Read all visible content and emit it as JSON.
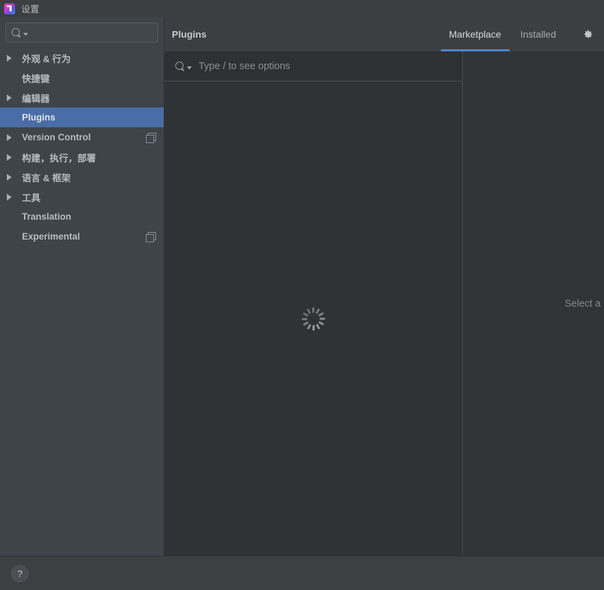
{
  "window": {
    "title": "设置",
    "app_icon": "pycharm-icon"
  },
  "sidebar": {
    "search": {
      "value": "",
      "placeholder": "",
      "icon": "search-icon"
    },
    "items": [
      {
        "label": "外观 & 行为",
        "expandable": true,
        "selected": false,
        "badge": ""
      },
      {
        "label": "快捷键",
        "expandable": false,
        "selected": false,
        "badge": ""
      },
      {
        "label": "编辑器",
        "expandable": true,
        "selected": false,
        "badge": ""
      },
      {
        "label": "Plugins",
        "expandable": false,
        "selected": true,
        "badge": ""
      },
      {
        "label": "Version Control",
        "expandable": true,
        "selected": false,
        "badge": "copy-icon"
      },
      {
        "label": "构建，执行，部署",
        "expandable": true,
        "selected": false,
        "badge": ""
      },
      {
        "label": "语言 & 框架",
        "expandable": true,
        "selected": false,
        "badge": ""
      },
      {
        "label": "工具",
        "expandable": true,
        "selected": false,
        "badge": ""
      },
      {
        "label": "Translation",
        "expandable": false,
        "selected": false,
        "badge": ""
      },
      {
        "label": "Experimental",
        "expandable": false,
        "selected": false,
        "badge": "copy-icon"
      }
    ]
  },
  "main": {
    "title": "Plugins",
    "tabs": [
      {
        "label": "Marketplace",
        "active": true
      },
      {
        "label": "Installed",
        "active": false
      }
    ],
    "settings_icon": "gear-icon",
    "search": {
      "value": "",
      "placeholder": "Type / to see options",
      "icon": "search-icon"
    },
    "list_status": "loading",
    "details_placeholder": "Select a plugin to see the details"
  },
  "footer": {
    "help_label": "?"
  },
  "colors": {
    "accent": "#4e87d4",
    "selection": "#4a6da7",
    "titlebar_bg": "#3b3f42",
    "sidebar_bg": "#3f434a",
    "main_bg": "#313436",
    "header_bg": "#3c3f41",
    "text": "#b7bcc1",
    "muted_text": "#83888c"
  }
}
